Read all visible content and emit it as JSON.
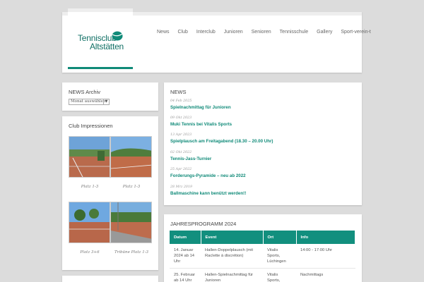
{
  "logo": {
    "line1": "Tennisclub",
    "line2": "Altstätten",
    "color": "#0f6f64"
  },
  "nav": [
    "News",
    "Club",
    "Interclub",
    "Junioren",
    "Senioren",
    "Tennisschule",
    "Gallery",
    "Sport-verein-t"
  ],
  "sidebar": {
    "archive": {
      "title": "NEWS Archiv",
      "select_value": "Monat auswählen"
    },
    "impressions": {
      "title": "Club Impressionen",
      "photos": [
        {
          "caption": "Platz 1-3"
        },
        {
          "caption": "Platz 1-3"
        },
        {
          "caption": "Platz 3+6"
        },
        {
          "caption": "Tribüne Platz 1-3"
        }
      ]
    }
  },
  "news": {
    "title": "NEWS",
    "items": [
      {
        "date": "04 Feb 2025",
        "title": "Spielnachmittag für Junioren"
      },
      {
        "date": "09 Okt 2023",
        "title": "Muki Tennis bei Vitalis Sports"
      },
      {
        "date": "13 Apr 2023",
        "title": "Spielplausch am Freitagabend (18.30 – 20.00 Uhr)"
      },
      {
        "date": "02 Okt 2022",
        "title": "Tennis-Jass-Turnier"
      },
      {
        "date": "25 Apr 2022",
        "title": "Forderungs-Pyramide – neu ab 2022"
      },
      {
        "date": "28 Mrz 2019",
        "title": "Ballmaschine kann benützt werden!!"
      }
    ]
  },
  "program": {
    "title": "JAHRESPROGRAMM 2024",
    "headers": [
      "Datum",
      "Event",
      "Ort",
      "Info"
    ],
    "rows": [
      {
        "datum": "14. Januar 2024 ab 14 Uhr",
        "event": "Hallen-Doppelplausch (mit Raclette à discrétion)",
        "ort": "Vitalis Sports, Lüchingen",
        "info": "14:00 - 17:00 Uhr"
      },
      {
        "datum": "25. Februar ab 14 Uhr",
        "event": "Hallen-Spielnachmittag für Junioren",
        "ort": "Vitalis Sports,",
        "info": "Nachmittags"
      }
    ]
  },
  "colors": {
    "accent": "#128f7e",
    "background": "#dcdcdc"
  }
}
